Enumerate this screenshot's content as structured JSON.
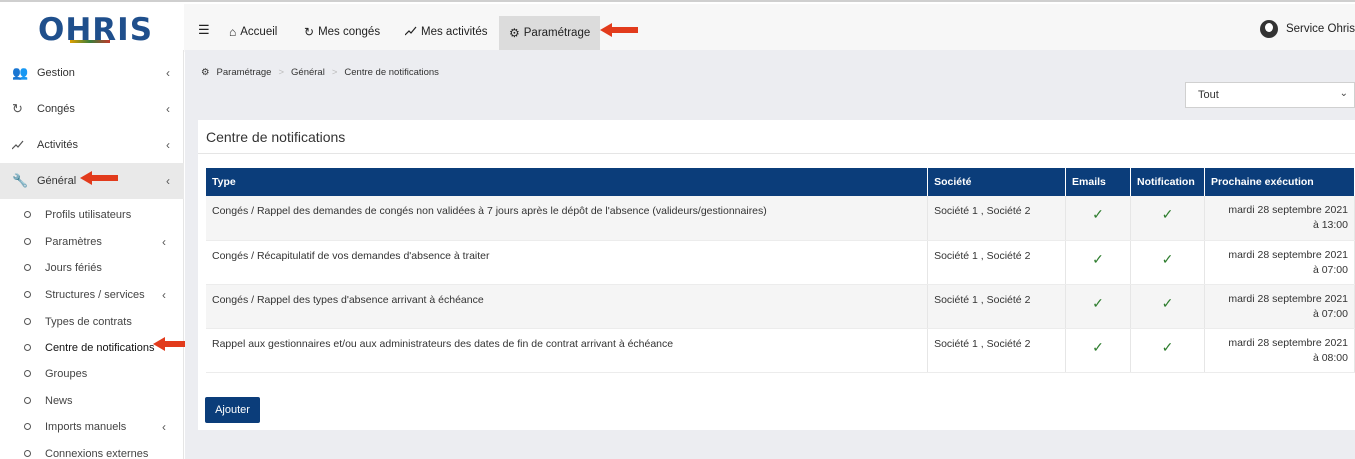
{
  "brand": {
    "logo_text": "OHRIS"
  },
  "topnav": {
    "menu_icon": "hamburger-icon",
    "items": [
      {
        "label": "Accueil",
        "icon": "home-icon"
      },
      {
        "label": "Mes congés",
        "icon": "refresh-icon"
      },
      {
        "label": "Mes activités",
        "icon": "trend-icon"
      },
      {
        "label": "Paramétrage",
        "icon": "gear-icon",
        "active": true
      }
    ],
    "user": {
      "name": "Service Ohris",
      "icon": "user-avatar-icon"
    }
  },
  "sidebar": {
    "items": [
      {
        "label": "Gestion",
        "icon": "users-icon"
      },
      {
        "label": "Congés",
        "icon": "refresh-icon"
      },
      {
        "label": "Activités",
        "icon": "trend-icon"
      },
      {
        "label": "Général",
        "icon": "wrench-icon",
        "open": true
      }
    ],
    "subitems": [
      {
        "label": "Profils utilisateurs"
      },
      {
        "label": "Paramètres",
        "has_children": true
      },
      {
        "label": "Jours fériés"
      },
      {
        "label": "Structures / services",
        "has_children": true
      },
      {
        "label": "Types de contrats"
      },
      {
        "label": "Centre de notifications",
        "current": true
      },
      {
        "label": "Groupes"
      },
      {
        "label": "News"
      },
      {
        "label": "Imports manuels",
        "has_children": true
      },
      {
        "label": "Connexions externes"
      }
    ]
  },
  "breadcrumb": [
    "Paramétrage",
    "Général",
    "Centre de notifications"
  ],
  "filter": {
    "selected": "Tout"
  },
  "panel": {
    "title": "Centre de notifications",
    "table": {
      "headers": [
        "Type",
        "Société",
        "Emails",
        "Notification",
        "Prochaine exécution"
      ],
      "rows": [
        {
          "type": "Congés / Rappel des demandes de congés non validées à 7 jours après le dépôt de l'absence (valideurs/gestionnaires)",
          "societe": "Société 1 , Société 2",
          "emails": "✓",
          "notification": "✓",
          "date_line1": "mardi 28 septembre 2021",
          "date_line2": "à 13:00"
        },
        {
          "type": "Congés / Récapitulatif de vos demandes d'absence à traiter",
          "societe": "Société 1 , Société 2",
          "emails": "✓",
          "notification": "✓",
          "date_line1": "mardi 28 septembre 2021",
          "date_line2": "à 07:00"
        },
        {
          "type": "Congés / Rappel des types d'absence arrivant à échéance",
          "societe": "Société 1 , Société 2",
          "emails": "✓",
          "notification": "✓",
          "date_line1": "mardi 28 septembre 2021",
          "date_line2": "à 07:00"
        },
        {
          "type": "Rappel aux gestionnaires et/ou aux administrateurs des dates de fin de contrat arrivant à échéance",
          "societe": "Société 1 , Société 2",
          "emails": "✓",
          "notification": "✓",
          "date_line1": "mardi 28 septembre 2021",
          "date_line2": "à 08:00"
        }
      ]
    },
    "add_button": "Ajouter"
  },
  "colors": {
    "header_blue": "#0b3d7a",
    "check_green": "#2e7d2e",
    "annotation_arrow": "#e23b1c"
  }
}
